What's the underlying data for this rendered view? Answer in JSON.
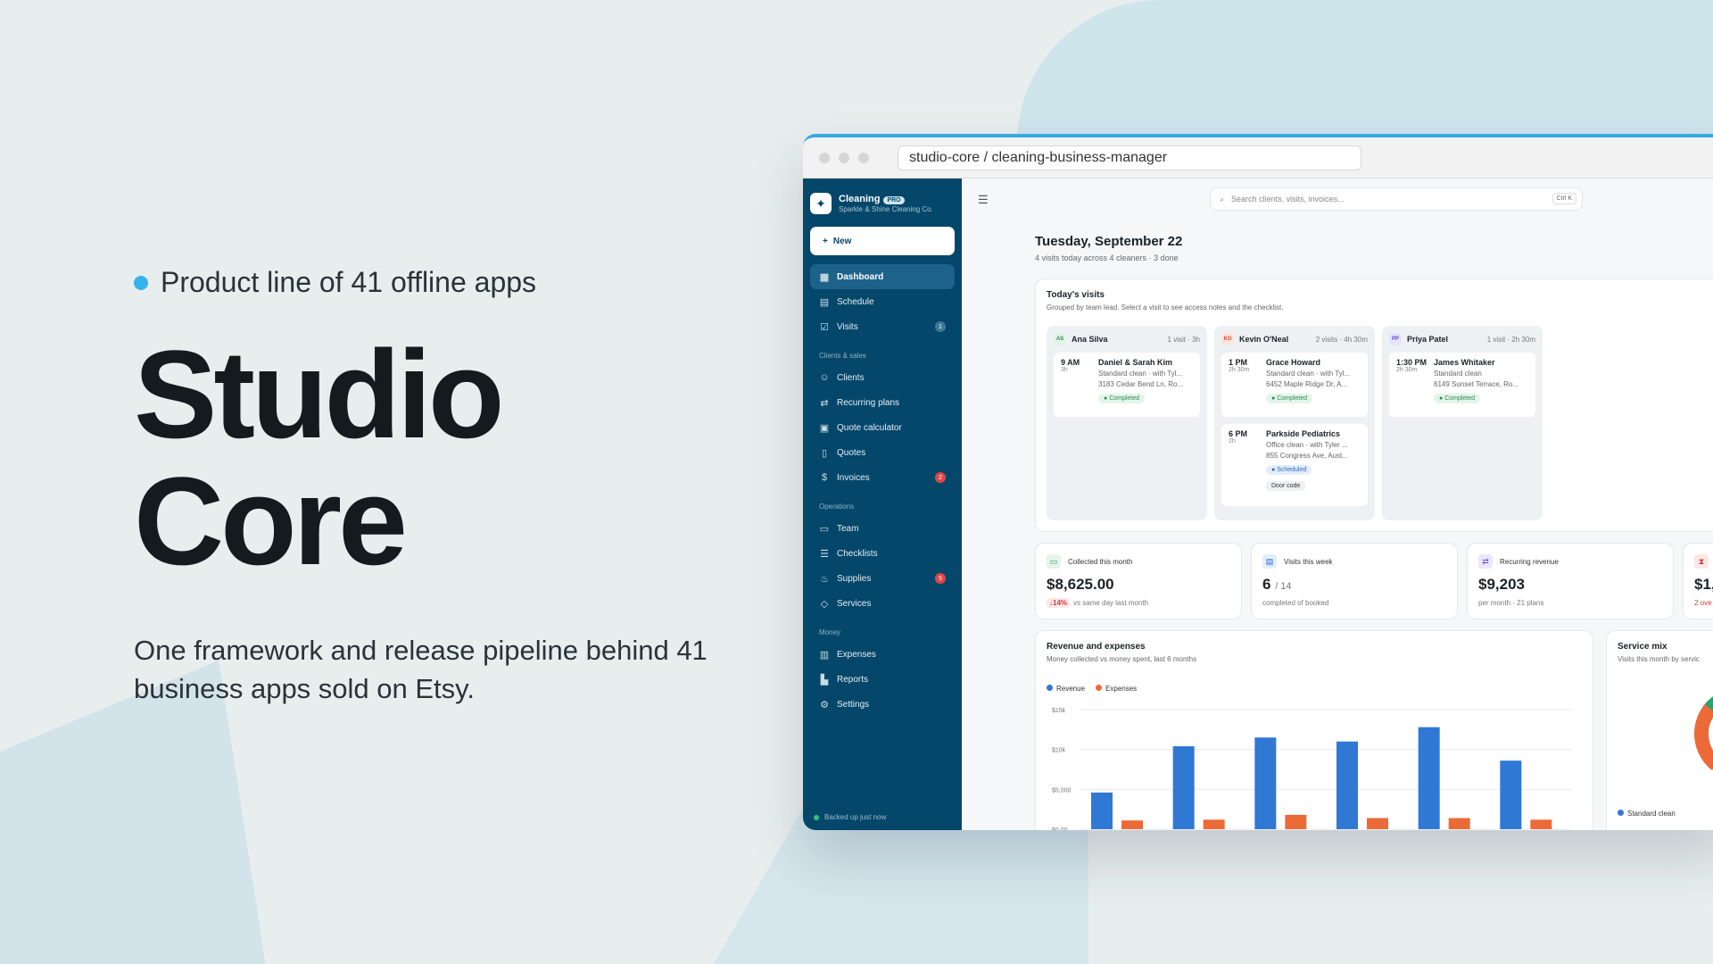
{
  "hero": {
    "eyebrow": "Product line of 41 offline apps",
    "title_line1": "Studio",
    "title_line2": "Core",
    "subtitle": "One framework and release pipeline behind 41 business apps sold on Etsy."
  },
  "browser": {
    "url": "studio-core / cleaning-business-manager"
  },
  "sidebar": {
    "app_name": "Cleaning",
    "plan_badge": "PRO",
    "company": "Sparkle & Shine Cleaning Co.",
    "new_label": "New",
    "items": [
      {
        "label": "Dashboard",
        "icon": "grid-icon"
      },
      {
        "label": "Schedule",
        "icon": "calendar-icon"
      },
      {
        "label": "Visits",
        "icon": "check-calendar-icon",
        "badge": "1"
      }
    ],
    "section_clients": "Clients & sales",
    "clients_items": [
      {
        "label": "Clients",
        "icon": "users-icon"
      },
      {
        "label": "Recurring plans",
        "icon": "repeat-icon"
      },
      {
        "label": "Quote calculator",
        "icon": "calculator-icon"
      },
      {
        "label": "Quotes",
        "icon": "document-icon"
      },
      {
        "label": "Invoices",
        "icon": "invoice-icon",
        "badge": "2"
      }
    ],
    "section_operations": "Operations",
    "operations_items": [
      {
        "label": "Team",
        "icon": "team-icon"
      },
      {
        "label": "Checklists",
        "icon": "checklist-icon"
      },
      {
        "label": "Supplies",
        "icon": "spray-icon",
        "badge": "5"
      },
      {
        "label": "Services",
        "icon": "tag-icon"
      }
    ],
    "section_money": "Money",
    "money_items": [
      {
        "label": "Expenses",
        "icon": "wallet-icon"
      },
      {
        "label": "Reports",
        "icon": "chart-icon"
      },
      {
        "label": "Settings",
        "icon": "gear-icon"
      }
    ],
    "backup_status": "Backed up just now"
  },
  "topbar": {
    "search_placeholder": "Search clients, visits, invoices...",
    "shortcut": "Ctrl K"
  },
  "header": {
    "date": "Tuesday, September 22",
    "summary": "4 visits today across 4 cleaners · 3 done"
  },
  "todays_visits": {
    "title": "Today's visits",
    "subtitle": "Grouped by team lead. Select a visit to see access notes and the checklist.",
    "columns": [
      {
        "initials": "AS",
        "name": "Ana Silva",
        "meta": "1 visit · 3h",
        "visits": [
          {
            "time": "9 AM",
            "duration": "3h",
            "client": "Daniel & Sarah Kim",
            "service": "Standard clean · with Tyl...",
            "address": "3183 Cedar Bend Ln, Ro...",
            "status": "Completed"
          }
        ]
      },
      {
        "initials": "KO",
        "name": "Kevin O'Neal",
        "meta": "2 visits · 4h 30m",
        "visits": [
          {
            "time": "1 PM",
            "duration": "2h 30m",
            "client": "Grace Howard",
            "service": "Standard clean · with Tyl...",
            "address": "6452 Maple Ridge Dr, A...",
            "status": "Completed"
          },
          {
            "time": "6 PM",
            "duration": "2h",
            "client": "Parkside Pediatrics",
            "service": "Office clean · with Tyler ...",
            "address": "855 Congress Ave, Aust...",
            "status": "Scheduled",
            "tag": "Door code"
          }
        ]
      },
      {
        "initials": "PP",
        "name": "Priya Patel",
        "meta": "1 visit · 2h 30m",
        "visits": [
          {
            "time": "1:30 PM",
            "duration": "2h 30m",
            "client": "James Whitaker",
            "service": "Standard clean",
            "address": "6149 Sunset Terrace, Ro...",
            "status": "Completed"
          }
        ]
      }
    ]
  },
  "stats": [
    {
      "label": "Collected this month",
      "value": "$8,625.00",
      "delta": "↓14%",
      "foot": "vs same day last month",
      "icon": "cash-icon"
    },
    {
      "label": "Visits this week",
      "value": "6",
      "value_suffix": "/ 14",
      "foot": "completed of booked",
      "icon": "calendar-icon"
    },
    {
      "label": "Recurring revenue",
      "value": "$9,203",
      "foot": "per month · 21 plans",
      "icon": "repeat-icon"
    },
    {
      "label": "",
      "value": "$1,",
      "foot": "2 ove",
      "icon": "hourglass-icon"
    }
  ],
  "revenue_card": {
    "title": "Revenue and expenses",
    "subtitle": "Money collected vs money spent, last 6 months"
  },
  "service_card": {
    "title": "Service mix",
    "subtitle": "Visits this month by servic",
    "legend_first": "Standard clean"
  },
  "chart_data": {
    "type": "bar",
    "title": "Revenue and expenses",
    "categories": [
      "",
      "",
      "",
      "",
      "",
      ""
    ],
    "series": [
      {
        "name": "Revenue",
        "values": [
          4600,
          10400,
          11500,
          11000,
          12800,
          8600
        ],
        "color": "#2f78d4"
      },
      {
        "name": "Expenses",
        "values": [
          1100,
          1200,
          1800,
          1400,
          1400,
          1200
        ],
        "color": "#ec6a37"
      }
    ],
    "yticks": [
      "$0.00",
      "$5,000",
      "$10k",
      "$15k"
    ],
    "ylim": [
      0,
      15000
    ],
    "legend": "top-left",
    "grid": true
  },
  "donut": {
    "colors": [
      "#2aa46b",
      "#ec6a37"
    ]
  },
  "colors": {
    "sidebar": "#05476b",
    "accent": "#38a9e0"
  }
}
